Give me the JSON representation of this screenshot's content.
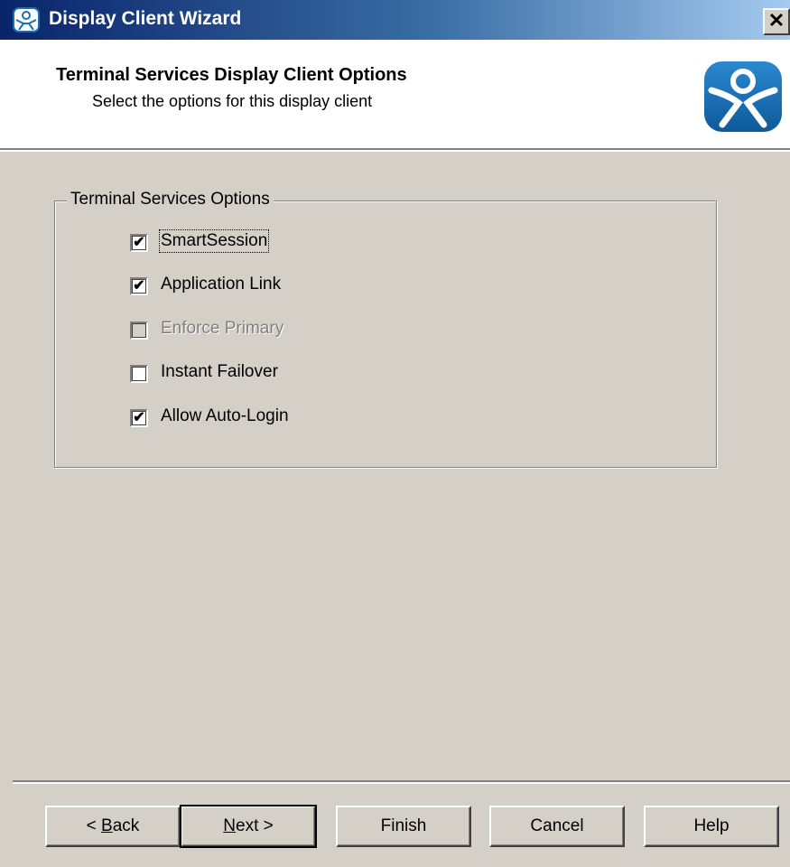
{
  "window": {
    "title": "Display Client Wizard",
    "close_label": "✕"
  },
  "header": {
    "title": "Terminal Services Display Client Options",
    "subtitle": "Select the options for this display client"
  },
  "group": {
    "legend": "Terminal Services Options",
    "options": [
      {
        "label": "SmartSession",
        "checked": true,
        "enabled": true,
        "focused": true
      },
      {
        "label": "Application Link",
        "checked": true,
        "enabled": true,
        "focused": false
      },
      {
        "label": "Enforce Primary",
        "checked": false,
        "enabled": false,
        "focused": false
      },
      {
        "label": "Instant Failover",
        "checked": false,
        "enabled": true,
        "focused": false
      },
      {
        "label": "Allow Auto-Login",
        "checked": true,
        "enabled": true,
        "focused": false
      }
    ]
  },
  "buttons": {
    "back": {
      "prefix": "< ",
      "mnemonic": "B",
      "rest": "ack"
    },
    "next": {
      "mnemonic": "N",
      "rest": "ext >"
    },
    "finish": "Finish",
    "cancel": "Cancel",
    "help": "Help"
  },
  "colors": {
    "dialog_bg": "#d4d0c8",
    "titlebar_start": "#0a246a",
    "titlebar_end": "#a6caf0",
    "logo_blue": "#1a6fb4"
  },
  "icons": {
    "title": "thinmanager-logo-icon",
    "header": "thinmanager-logo-icon",
    "checkmark": "✔"
  }
}
